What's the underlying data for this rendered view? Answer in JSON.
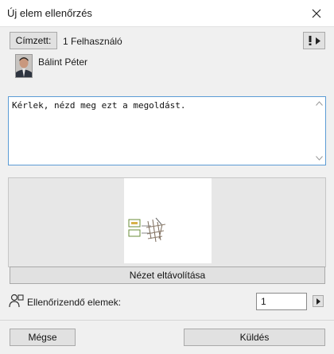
{
  "window": {
    "title": "Új elem ellenőrzés"
  },
  "recipients": {
    "button_label": "Címzett:",
    "count_text": "1 Felhasználó"
  },
  "user": {
    "name": "Bálint Péter"
  },
  "message": {
    "text": "Kérlek, nézd meg ezt a megoldást."
  },
  "preview": {
    "remove_label": "Nézet eltávolítása"
  },
  "check": {
    "label": "Ellenőrizendő elemek:",
    "value": "1"
  },
  "footer": {
    "cancel_label": "Mégse",
    "send_label": "Küldés"
  }
}
